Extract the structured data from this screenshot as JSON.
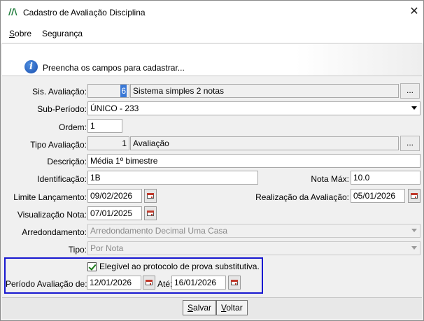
{
  "window": {
    "title": "Cadastro de Avaliação Disciplina",
    "close_symbol": "✕"
  },
  "menu": {
    "items": [
      {
        "label_u": "S",
        "label_rest": "obre"
      },
      {
        "label": "Segurança"
      }
    ]
  },
  "info_message": "Preencha os campos para cadastrar...",
  "form": {
    "sis_avaliacao": {
      "label": "Sis. Avaliação:",
      "code": "6",
      "text": "Sistema simples 2 notas",
      "button": "..."
    },
    "sub_periodo": {
      "label": "Sub-Período:",
      "value": "ÚNICO - 233"
    },
    "ordem": {
      "label": "Ordem:",
      "value": "1"
    },
    "tipo_avaliacao": {
      "label": "Tipo Avaliação:",
      "code": "1",
      "text": "Avaliação",
      "button": "..."
    },
    "descricao": {
      "label": "Descrição:",
      "value": "Média 1º bimestre"
    },
    "identificacao": {
      "label": "Identificação:",
      "value": "1B"
    },
    "nota_max": {
      "label": "Nota Máx:",
      "value": "10.0"
    },
    "limite_lancamento": {
      "label": "Limite Lançamento:",
      "value": "09/02/2026"
    },
    "realizacao_avaliacao": {
      "label": "Realização da Avaliação:",
      "value": "05/01/2026"
    },
    "visualizacao_nota": {
      "label": "Visualização Nota:",
      "value": "07/01/2025"
    },
    "arredondamento": {
      "label": "Arredondamento:",
      "value": "Arredondamento Decimal Uma Casa"
    },
    "tipo": {
      "label": "Tipo:",
      "value": "Por Nota"
    },
    "elegivel": {
      "label": "Elegível ao protocolo de prova substitutiva.",
      "checked": true
    },
    "periodo_avaliacao": {
      "label": "Período Avaliação de:",
      "from": "12/01/2026",
      "to_label": "Até:",
      "to": "16/01/2026"
    }
  },
  "buttons": {
    "save_u": "S",
    "save_rest": "alvar",
    "back_u": "V",
    "back_rest": "oltar"
  }
}
